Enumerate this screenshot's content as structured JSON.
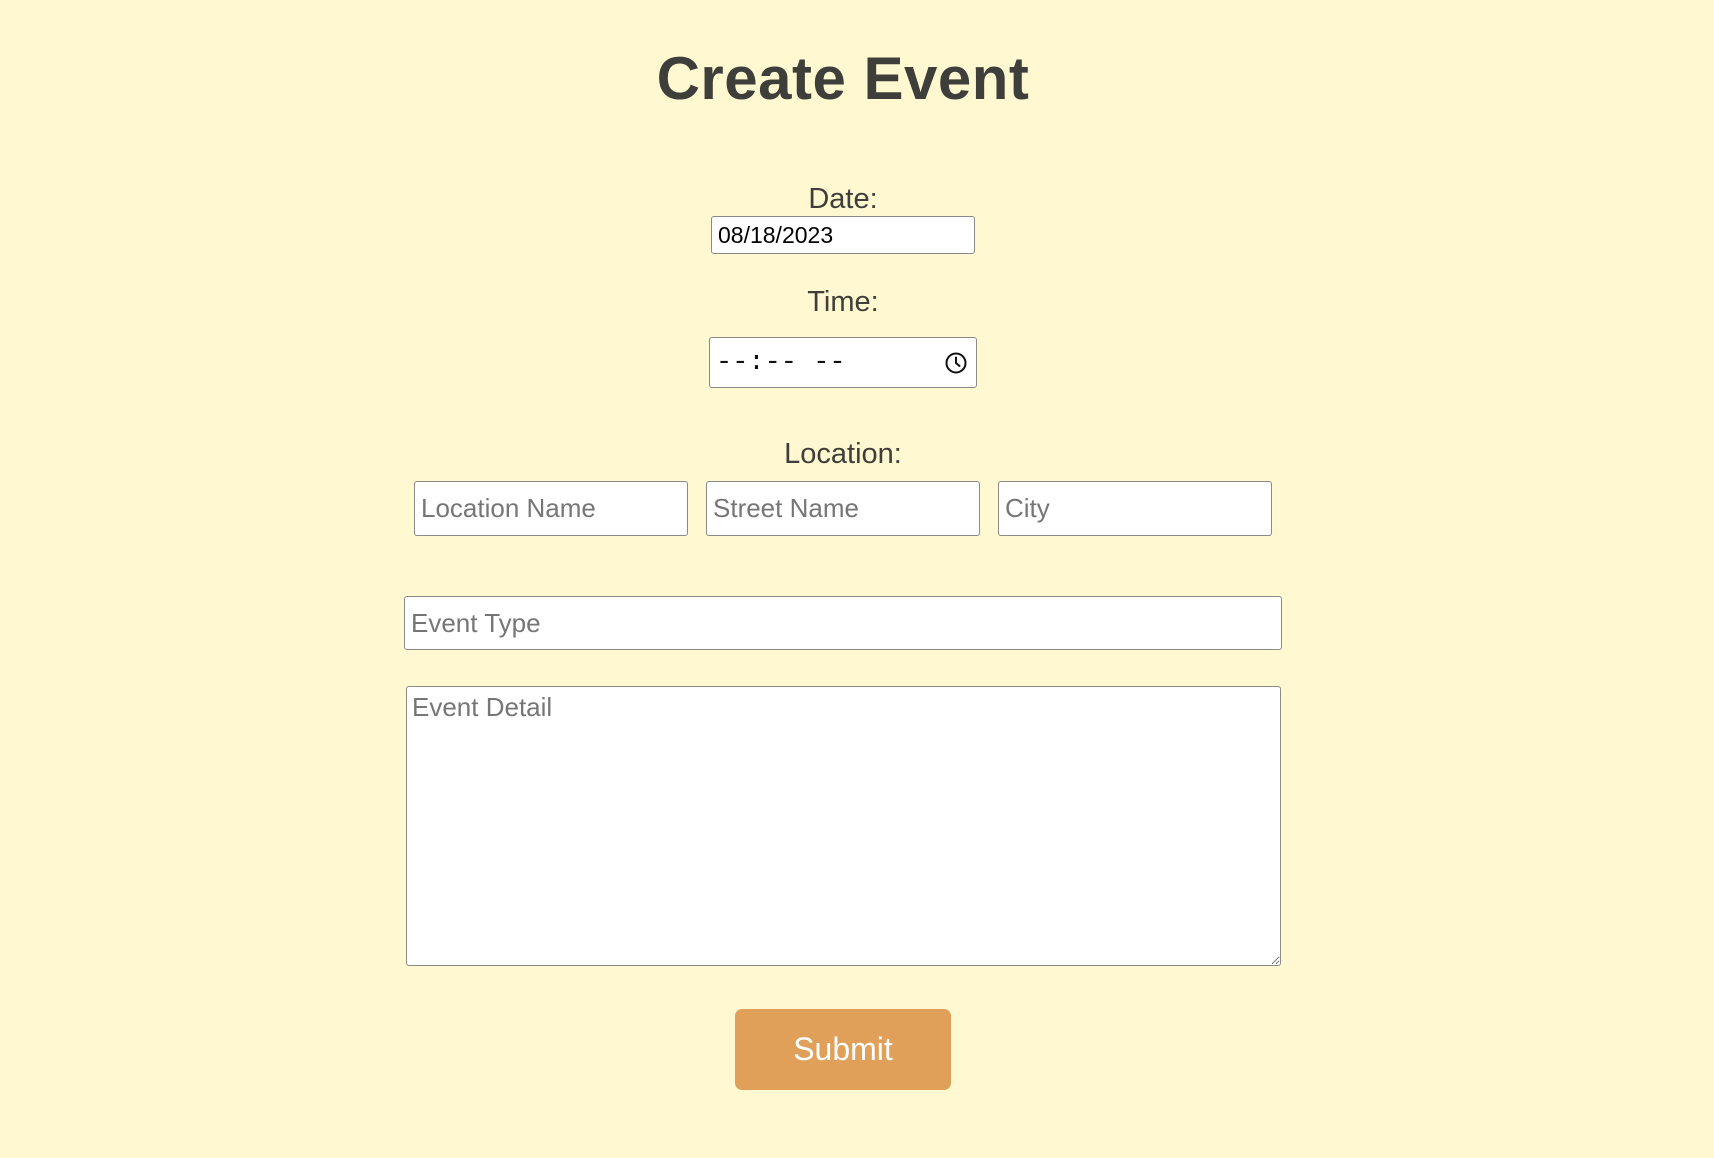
{
  "page": {
    "title": "Create Event",
    "background_color": "#fff8d0"
  },
  "form": {
    "date": {
      "label": "Date:",
      "value": "08/18/2023"
    },
    "time": {
      "label": "Time:",
      "value": "--:-- --",
      "icon": "clock-icon"
    },
    "location": {
      "label": "Location:",
      "name_placeholder": "Location Name",
      "street_placeholder": "Street Name",
      "city_placeholder": "City"
    },
    "event_type": {
      "placeholder": "Event Type"
    },
    "event_detail": {
      "placeholder": "Event Detail"
    },
    "submit": {
      "label": "Submit",
      "color": "#e1a05a"
    }
  }
}
